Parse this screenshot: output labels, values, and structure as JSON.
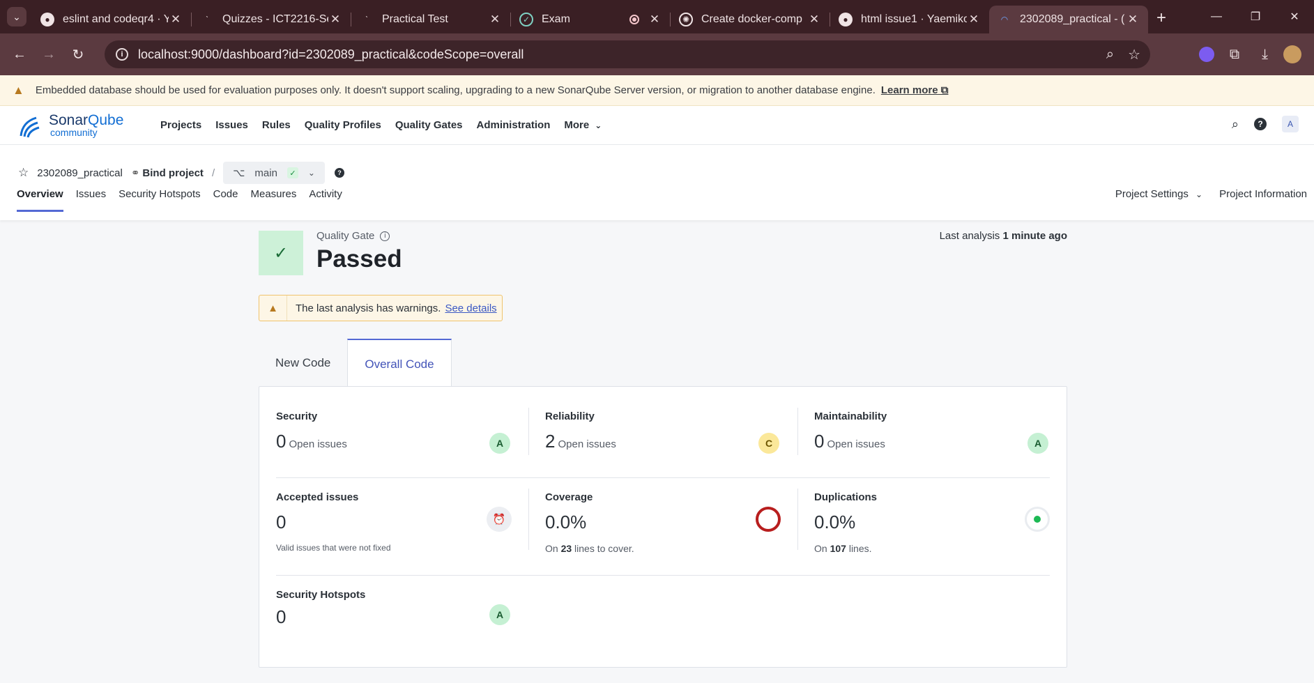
{
  "browser": {
    "tabs": [
      {
        "title": "eslint and codeqr4 · Y",
        "favicon": "github-icon"
      },
      {
        "title": "Quizzes - ICT2216-Se",
        "favicon": "brand-icon"
      },
      {
        "title": "Practical Test",
        "favicon": "brand-icon"
      },
      {
        "title": "Exam",
        "favicon": "check-circle-icon"
      },
      {
        "title": "Create docker-comp",
        "favicon": "openai-icon"
      },
      {
        "title": "html issue1 · Yaemiko",
        "favicon": "github-icon"
      },
      {
        "title": "2302089_practical - (",
        "favicon": "sonarqube-icon"
      }
    ],
    "url": "localhost:9000/dashboard?id=2302089_practical&codeScope=overall"
  },
  "banner": {
    "text": "Embedded database should be used for evaluation purposes only. It doesn't support scaling, upgrading to a new SonarQube Server version, or migration to another database engine.",
    "link": "Learn more"
  },
  "header": {
    "logo_main_a": "Sonar",
    "logo_main_b": "Qube",
    "logo_sub": "community",
    "nav": [
      "Projects",
      "Issues",
      "Rules",
      "Quality Profiles",
      "Quality Gates",
      "Administration",
      "More"
    ],
    "avatar": "A"
  },
  "project": {
    "name": "2302089_practical",
    "bind": "Bind project",
    "branch": "main",
    "tabs": [
      "Overview",
      "Issues",
      "Security Hotspots",
      "Code",
      "Measures",
      "Activity"
    ],
    "settings": "Project Settings",
    "info": "Project Information"
  },
  "quality_gate": {
    "label": "Quality Gate",
    "status": "Passed",
    "last_analysis_label": "Last analysis",
    "last_analysis_value": "1 minute ago"
  },
  "warning": {
    "text": "The last analysis has warnings.",
    "link": "See details"
  },
  "code_tabs": [
    "New Code",
    "Overall Code"
  ],
  "metrics": {
    "security": {
      "title": "Security",
      "value": "0",
      "unit": "Open issues",
      "grade": "A"
    },
    "reliability": {
      "title": "Reliability",
      "value": "2",
      "unit": "Open issues",
      "grade": "C"
    },
    "maintainability": {
      "title": "Maintainability",
      "value": "0",
      "unit": "Open issues",
      "grade": "A"
    },
    "accepted": {
      "title": "Accepted issues",
      "value": "0",
      "sub": "Valid issues that were not fixed"
    },
    "coverage": {
      "title": "Coverage",
      "value": "0.0%",
      "sub_pre": "On",
      "sub_num": "23",
      "sub_post": "lines to cover."
    },
    "duplications": {
      "title": "Duplications",
      "value": "0.0%",
      "sub_pre": "On",
      "sub_num": "107",
      "sub_post": "lines."
    },
    "hotspots": {
      "title": "Security Hotspots",
      "value": "0",
      "grade": "A"
    }
  },
  "colors": {
    "accent": "#5469d4",
    "passed_bg": "#cdf1d8",
    "grade_a": "#c5f0d3",
    "grade_c": "#fbe89a",
    "coverage_ring": "#b81e1e",
    "dup_dot": "#1db954"
  }
}
